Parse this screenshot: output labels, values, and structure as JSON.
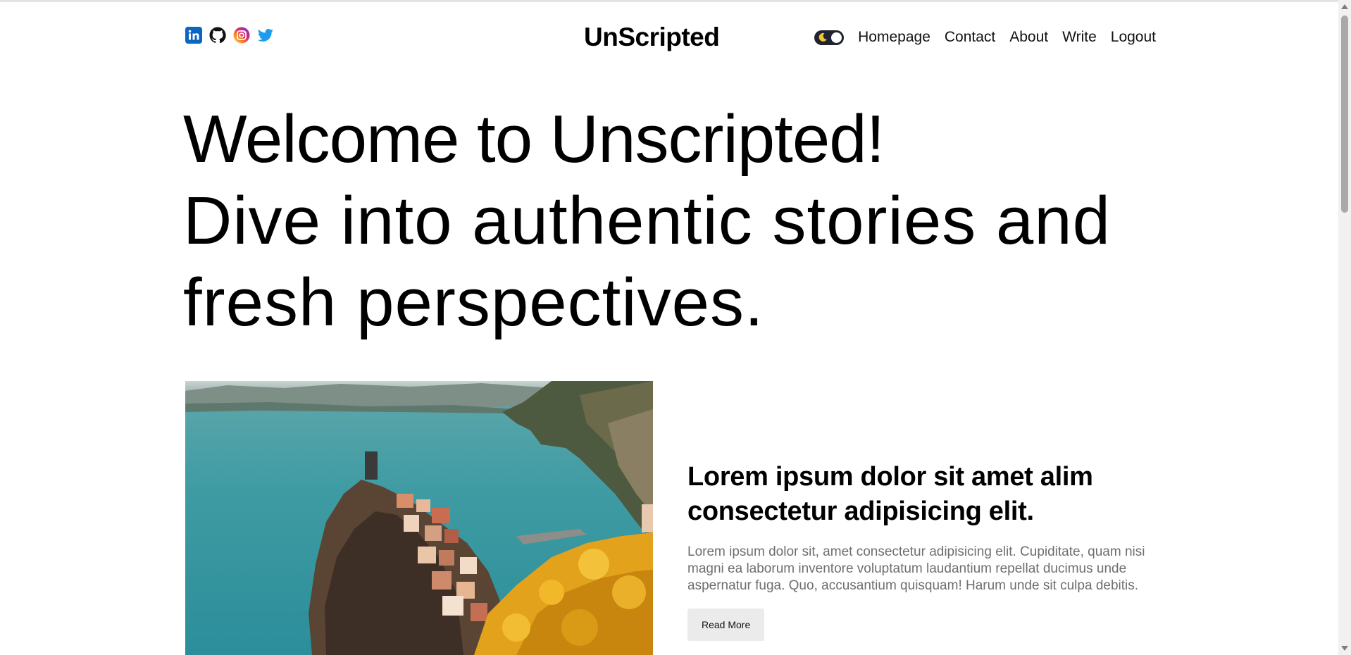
{
  "header": {
    "site_title": "UnScripted",
    "socials": [
      {
        "icon": "linkedin-icon"
      },
      {
        "icon": "github-icon"
      },
      {
        "icon": "instagram-icon"
      },
      {
        "icon": "twitter-icon"
      }
    ],
    "nav": {
      "theme_toggle_icon": "moon-icon",
      "links": [
        "Homepage",
        "Contact",
        "About",
        "Write",
        "Logout"
      ]
    }
  },
  "hero": {
    "line1": "Welcome to Unscripted!",
    "line2": "Dive into authentic stories and fresh perspectives."
  },
  "featured_post": {
    "image": "coastal-village-photo",
    "title": "Lorem ipsum dolor sit amet alim consectetur adipisicing elit.",
    "excerpt": "Lorem ipsum dolor sit, amet consectetur adipisicing elit. Cupiditate, quam nisi magni ea laborum inventore voluptatum laudantium repellat ducimus unde aspernatur fuga. Quo, accusantium quisquam! Harum unde sit culpa debitis.",
    "button_label": "Read More"
  },
  "colors": {
    "linkedin": "#0a66c2",
    "twitter": "#1d9bf0",
    "toggle_bg": "#1f2430",
    "excerpt_text": "#6e6e6e",
    "button_bg": "#ebebeb"
  }
}
